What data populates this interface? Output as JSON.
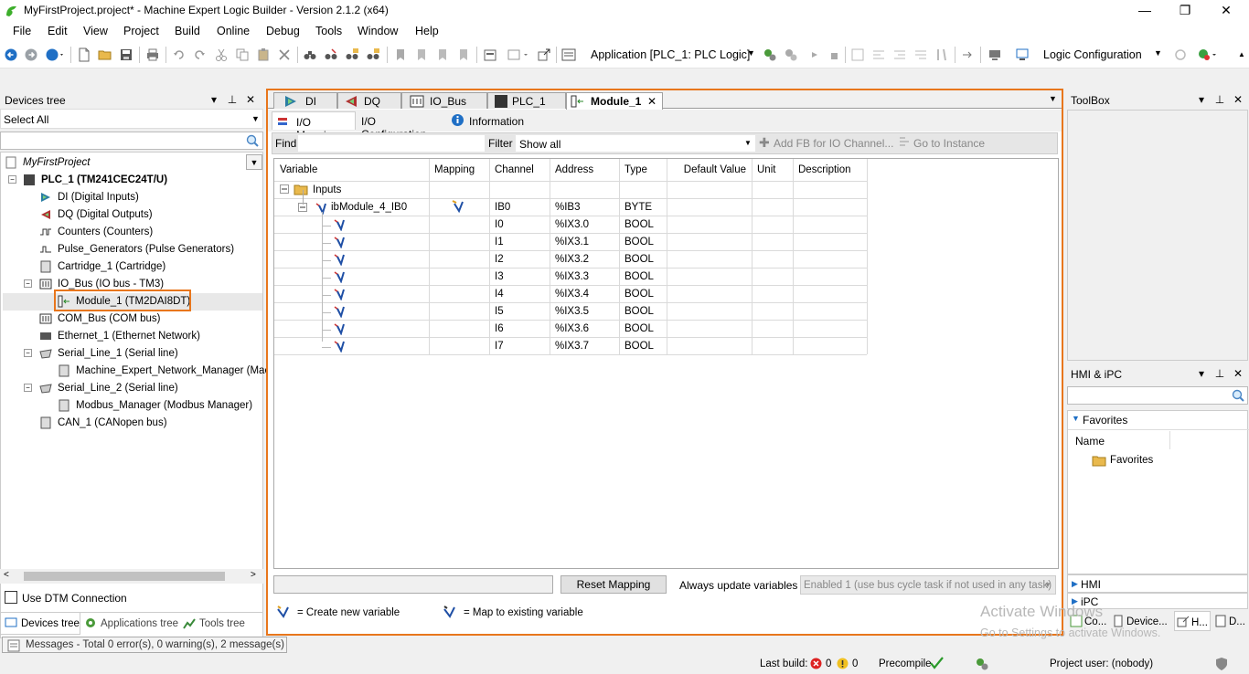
{
  "window": {
    "title": "MyFirstProject.project* - Machine Expert Logic Builder - Version 2.1.2 (x64)",
    "minimize": "—",
    "restore": "❐",
    "close": "✕"
  },
  "menu": [
    "File",
    "Edit",
    "View",
    "Project",
    "Build",
    "Online",
    "Debug",
    "Tools",
    "Window",
    "Help"
  ],
  "toolbar": {
    "application_combo": "Application [PLC_1: PLC Logic]",
    "logic_combo": "Logic Configuration"
  },
  "devices_tree": {
    "title": "Devices tree",
    "select_label": "Select All",
    "search_placeholder": "",
    "project_combo": "MyFirstProject",
    "plc": "PLC_1 (TM241CEC24T/U)",
    "items": [
      {
        "label": "DI (Digital Inputs)",
        "icon": "digital-input-icon"
      },
      {
        "label": "DQ (Digital Outputs)",
        "icon": "digital-output-icon"
      },
      {
        "label": "Counters (Counters)",
        "icon": "counter-icon"
      },
      {
        "label": "Pulse_Generators (Pulse Generators)",
        "icon": "pulse-icon"
      },
      {
        "label": "Cartridge_1 (Cartridge)",
        "icon": "cartridge-icon"
      },
      {
        "label": "IO_Bus (IO bus - TM3)",
        "icon": "bus-icon"
      },
      {
        "label": "Module_1 (TM2DAI8DT)",
        "icon": "module-icon"
      },
      {
        "label": "COM_Bus (COM bus)",
        "icon": "bus-icon"
      },
      {
        "label": "Ethernet_1 (Ethernet Network)",
        "icon": "ethernet-icon"
      },
      {
        "label": "Serial_Line_1 (Serial line)",
        "icon": "serial-icon"
      },
      {
        "label": "Machine_Expert_Network_Manager (Mach",
        "icon": "manager-icon"
      },
      {
        "label": "Serial_Line_2 (Serial line)",
        "icon": "serial-icon"
      },
      {
        "label": "Modbus_Manager (Modbus Manager)",
        "icon": "manager-icon"
      },
      {
        "label": "CAN_1 (CANopen bus)",
        "icon": "can-icon"
      }
    ],
    "use_dtm": "Use DTM Connection",
    "bottom_tabs": [
      "Devices tree",
      "Applications tree",
      "Tools tree"
    ]
  },
  "editor": {
    "doc_tabs": [
      "DI",
      "DQ",
      "IO_Bus",
      "PLC_1",
      "Module_1"
    ],
    "sub_tabs": [
      "I/O Mapping",
      "I/O Configuration",
      "Information"
    ],
    "find_label": "Find",
    "filter_label": "Filter",
    "filter_value": "Show all",
    "add_fb": "Add FB for IO Channel...",
    "go_instance": "Go to Instance",
    "columns": [
      "Variable",
      "Mapping",
      "Channel",
      "Address",
      "Type",
      "Default Value",
      "Unit",
      "Description"
    ],
    "group": "Inputs",
    "byte_row": {
      "variable": "ibModule_4_IB0",
      "channel": "IB0",
      "address": "%IB3",
      "type": "BYTE"
    },
    "rows": [
      {
        "channel": "I0",
        "address": "%IX3.0",
        "type": "BOOL"
      },
      {
        "channel": "I1",
        "address": "%IX3.1",
        "type": "BOOL"
      },
      {
        "channel": "I2",
        "address": "%IX3.2",
        "type": "BOOL"
      },
      {
        "channel": "I3",
        "address": "%IX3.3",
        "type": "BOOL"
      },
      {
        "channel": "I4",
        "address": "%IX3.4",
        "type": "BOOL"
      },
      {
        "channel": "I5",
        "address": "%IX3.5",
        "type": "BOOL"
      },
      {
        "channel": "I6",
        "address": "%IX3.6",
        "type": "BOOL"
      },
      {
        "channel": "I7",
        "address": "%IX3.7",
        "type": "BOOL"
      }
    ],
    "reset_mapping": "Reset Mapping",
    "always_update": "Always update variables",
    "update_value": "Enabled 1 (use bus cycle task if not used in any task)",
    "legend_create": "= Create new variable",
    "legend_map": "= Map to existing variable"
  },
  "toolbox": {
    "title": "ToolBox"
  },
  "hmi": {
    "title": "HMI & iPC",
    "favorites_section": "Favorites",
    "name_col": "Name",
    "favorites_item": "Favorites",
    "hmi_section": "HMI",
    "ipc_section": "iPC",
    "bottom_tabs": [
      "Co...",
      "Device...",
      "H...",
      "D..."
    ]
  },
  "watermark": {
    "line1": "Activate Windows",
    "line2": "Go to Settings to activate Windows."
  },
  "statusbar": {
    "messages": "Messages - Total 0 error(s), 0 warning(s), 2 message(s)",
    "last_build": "Last build:",
    "errors": "0",
    "warnings": "0",
    "precompile": "Precompile",
    "project_user": "Project user: (nobody)"
  },
  "colors": {
    "accent": "#e8761c",
    "selection": "#cce4f7"
  }
}
